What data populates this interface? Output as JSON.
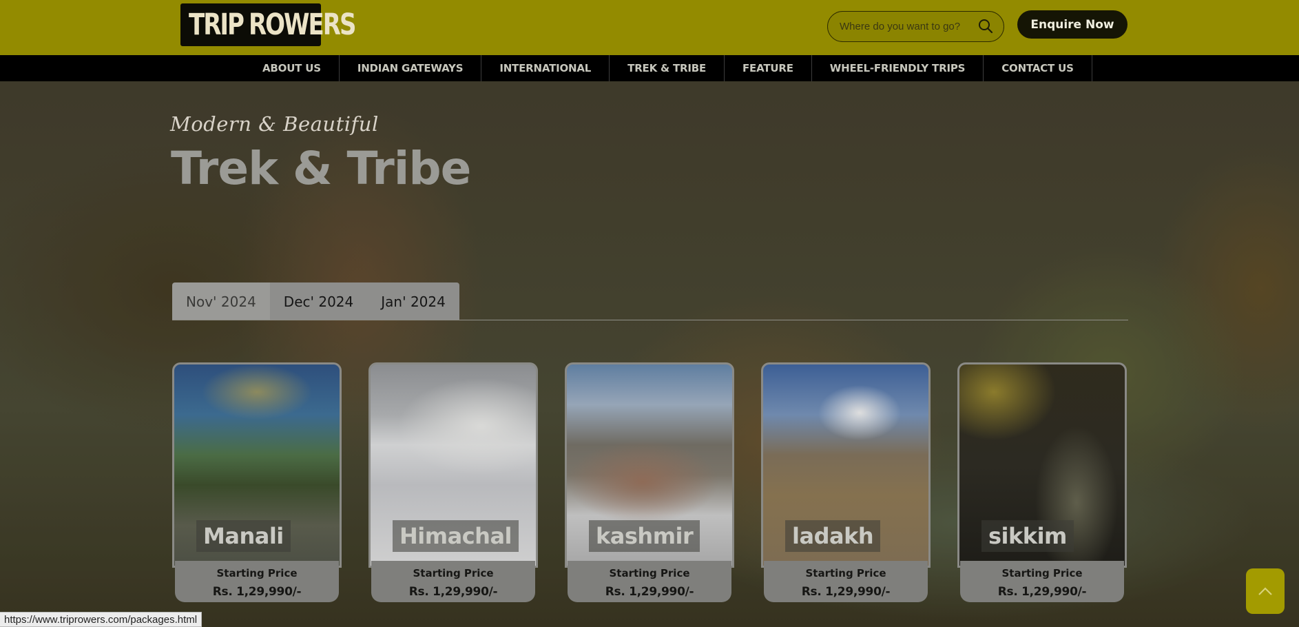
{
  "header": {
    "logo_left": "TRIP",
    "logo_right": "ROWERS",
    "search_placeholder": "Where do you want to go?",
    "enquire_label": "Enquire Now"
  },
  "nav": {
    "items": [
      "ABOUT US",
      "INDIAN GATEWAYS",
      "INTERNATIONAL",
      "TREK & TRIBE",
      "FEATURE",
      "WHEEL-FRIENDLY TRIPS",
      "CONTACT US"
    ]
  },
  "hero": {
    "tagline": "Modern & Beautiful",
    "title": "Trek & Tribe"
  },
  "tabs": {
    "items": [
      "Nov' 2024",
      "Dec' 2024",
      "Jan' 2024"
    ],
    "active": "Nov' 2024"
  },
  "cards": [
    {
      "name": "Manali",
      "price_label": "Starting Price",
      "price": "Rs. 1,29,990/-"
    },
    {
      "name": "Himachal",
      "price_label": "Starting Price",
      "price": "Rs. 1,29,990/-"
    },
    {
      "name": "kashmir",
      "price_label": "Starting Price",
      "price": "Rs. 1,29,990/-"
    },
    {
      "name": "ladakh",
      "price_label": "Starting Price",
      "price": "Rs. 1,29,990/-"
    },
    {
      "name": "sikkim",
      "price_label": "Starting Price",
      "price": "Rs. 1,29,990/-"
    }
  ],
  "status_bar": {
    "url": "https://www.triprowers.com/packages.html"
  },
  "colors": {
    "header_bg": "#938b00",
    "nav_bg": "#000000",
    "button_dark": "#151505"
  },
  "icons": {
    "search": "search-icon",
    "back_to_top": "chevron-up-icon"
  }
}
